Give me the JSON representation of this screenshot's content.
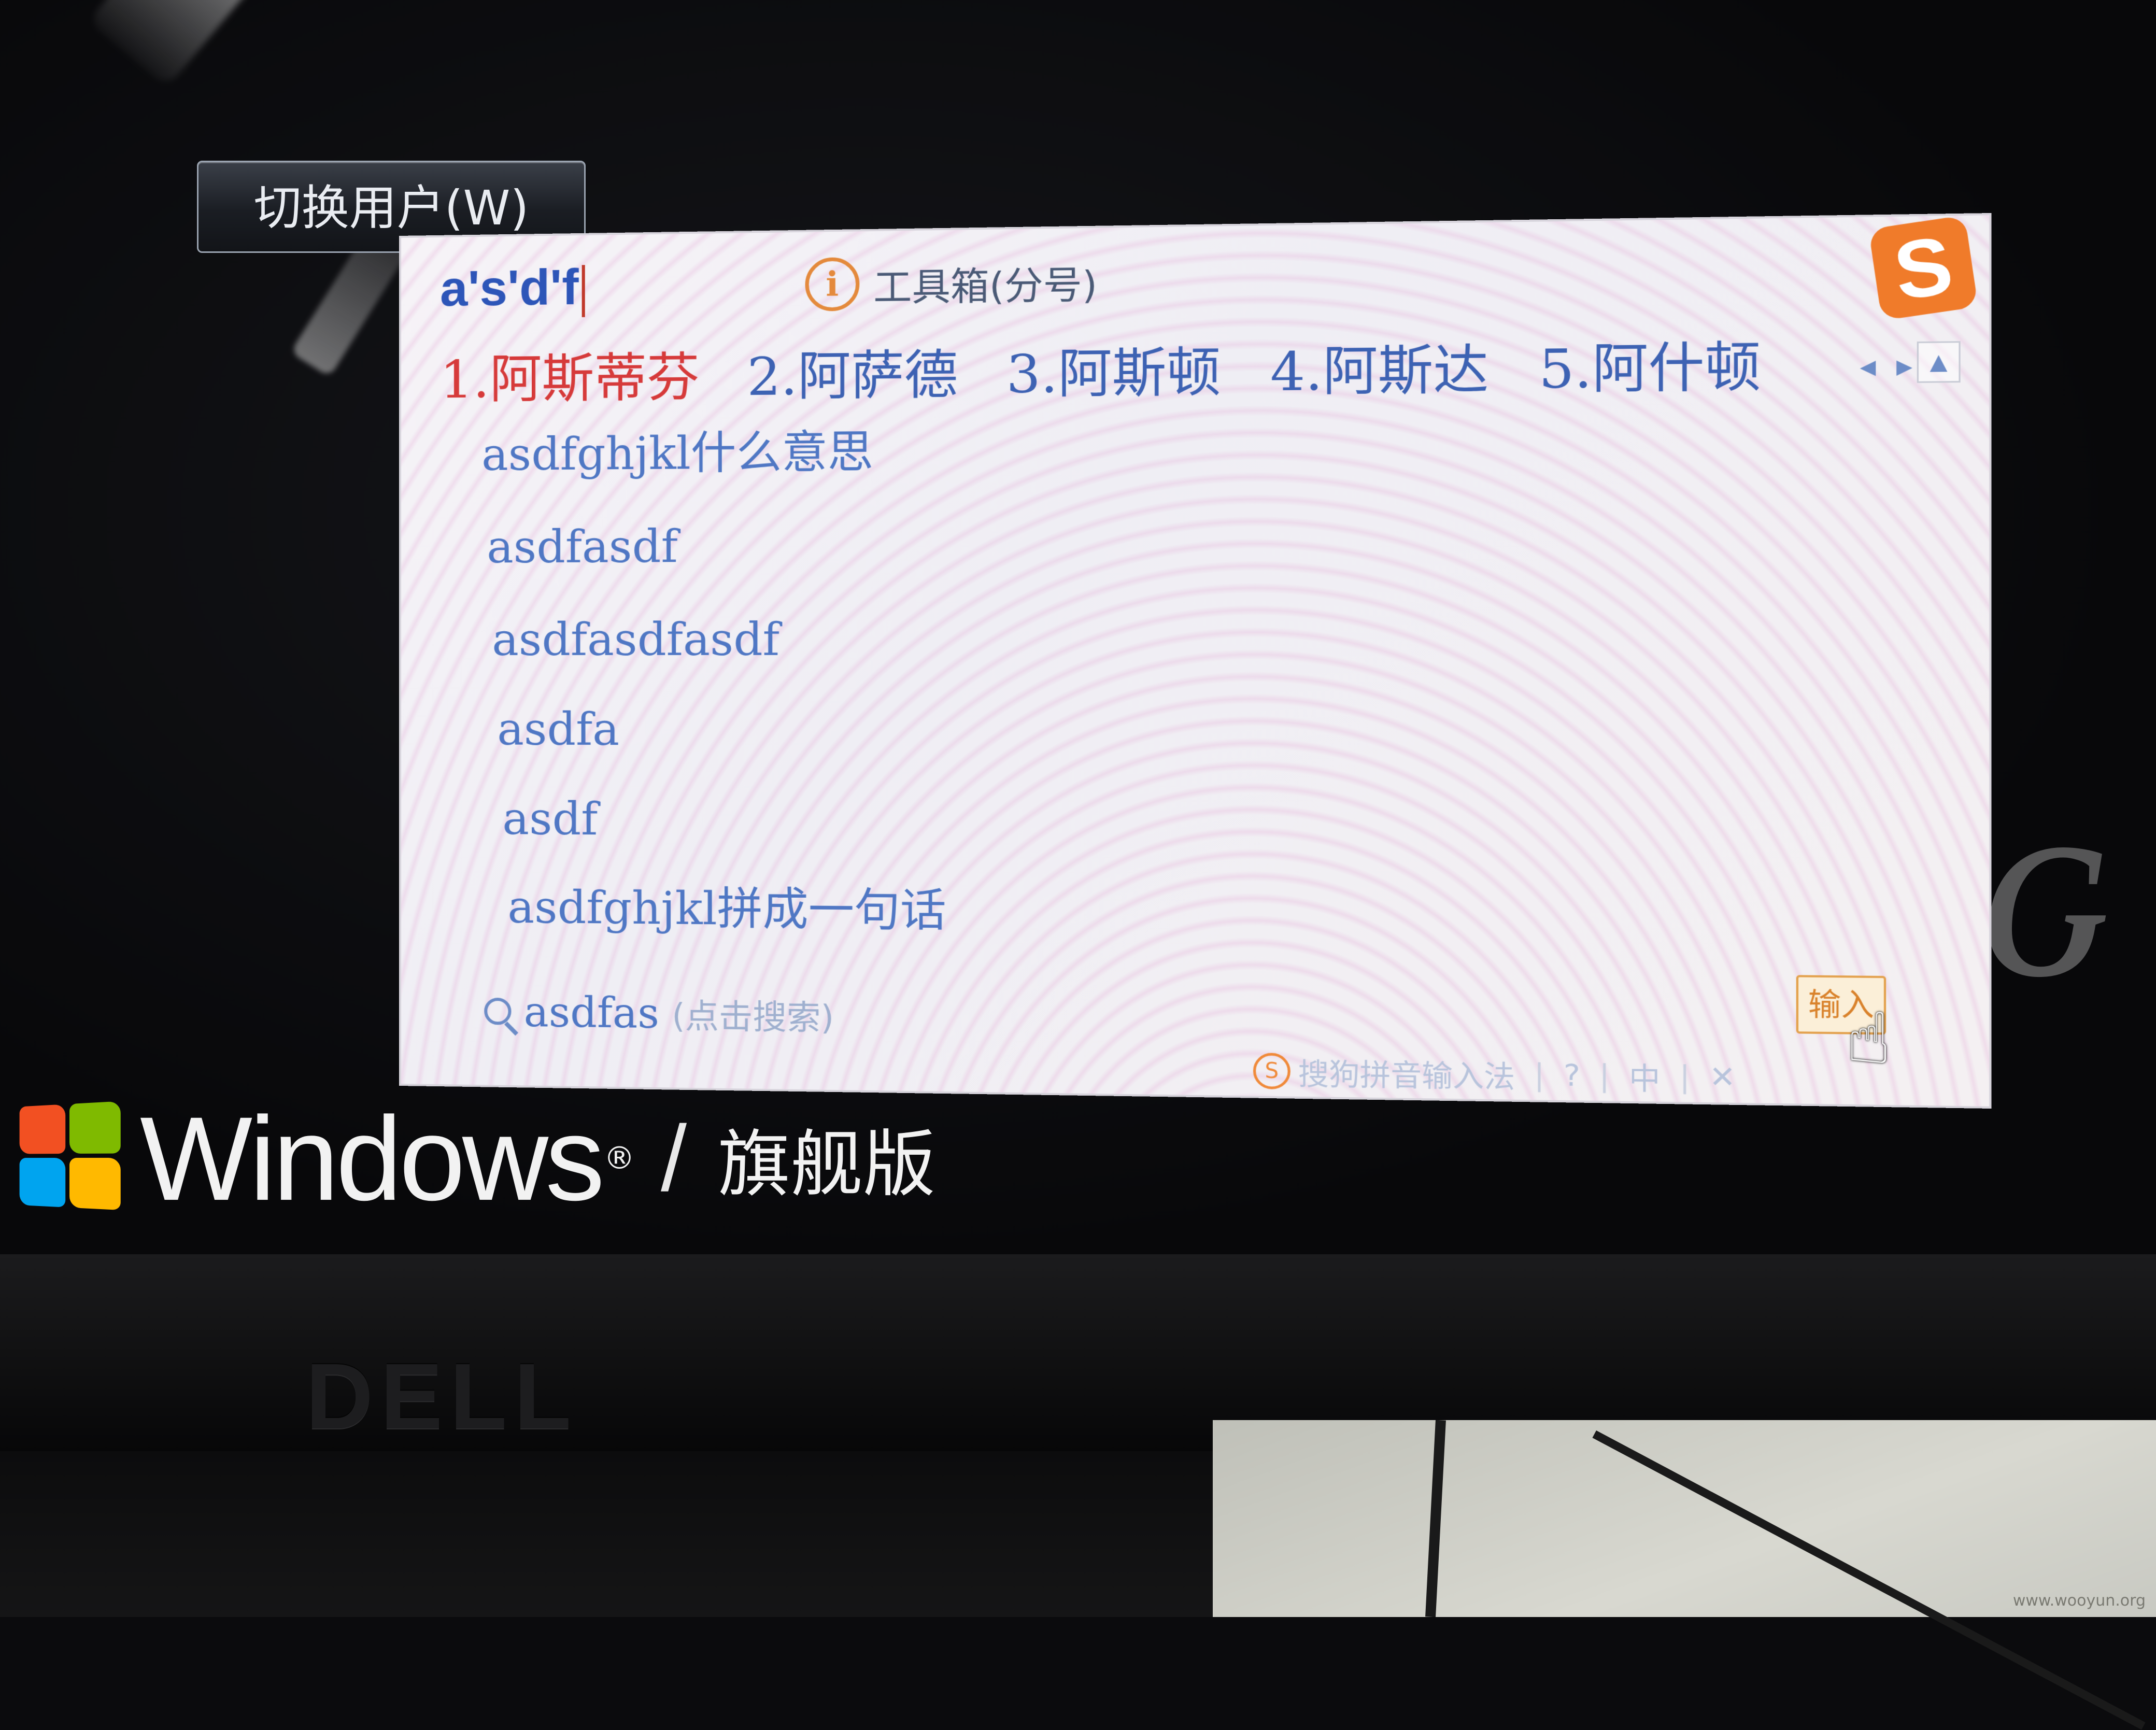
{
  "switch_user": {
    "label": "切换用户(W)"
  },
  "ime": {
    "pinyin_input": "a's'd'f",
    "toolbox_icon": "info-icon",
    "toolbox_label": "工具箱(分号)",
    "logo_letter": "S",
    "candidates": [
      "1.阿斯蒂芬",
      "2.阿萨德",
      "3.阿斯顿",
      "4.阿斯达",
      "5.阿什顿"
    ],
    "suggestions": [
      "asdfghjkl什么意思",
      "asdfasdf",
      "asdfasdfasdf",
      "asdfa",
      "asdf",
      "asdfghjkl拼成一句话"
    ],
    "search": {
      "query": "asdfas",
      "hint": "(点击搜索)"
    },
    "input_button": "输入",
    "status": {
      "logo": "S",
      "text": "搜狗拼音输入法",
      "help": "?",
      "lang": "中"
    },
    "colors": {
      "candidate_first": "#d63a3a",
      "candidate": "#3d62b3",
      "suggestion": "#4f77c4",
      "logo": "#f07b2a"
    }
  },
  "windows": {
    "word": "Windows",
    "registered": "®",
    "slash": "/",
    "edition": "旗舰版"
  },
  "monitor": {
    "brand": "DELL"
  },
  "watermark": "www.wooyun.org"
}
